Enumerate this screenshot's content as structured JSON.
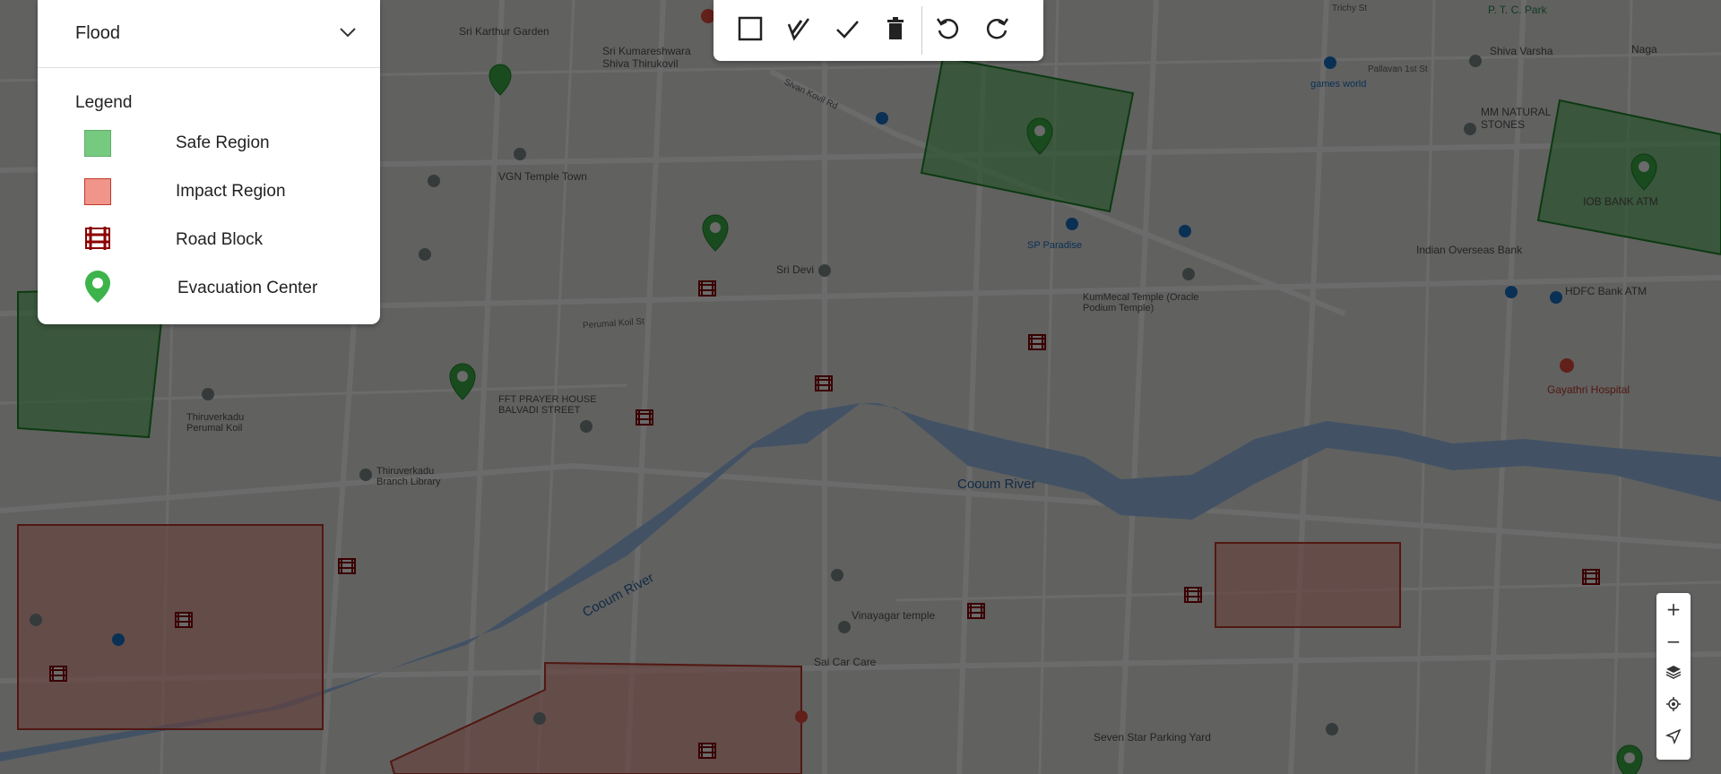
{
  "hazard_select": {
    "value": "Flood"
  },
  "legend": {
    "title": "Legend",
    "items": [
      {
        "label": "Safe Region",
        "color": "#3cb44b"
      },
      {
        "label": "Impact Region",
        "color": "#f1948a"
      },
      {
        "label": "Road Block",
        "icon": "road-block-icon"
      },
      {
        "label": "Evacuation Center",
        "icon": "evacuation-pin-icon"
      }
    ]
  },
  "toolbar": {
    "buttons": [
      {
        "icon": "rectangle-icon"
      },
      {
        "icon": "polyline-edit-icon"
      },
      {
        "icon": "check-icon"
      },
      {
        "icon": "trash-icon"
      },
      {
        "icon": "undo-icon"
      },
      {
        "icon": "redo-icon"
      }
    ]
  },
  "zoom_controls": {
    "zoom_in": "+",
    "zoom_out": "−"
  },
  "map": {
    "labels": [
      {
        "text": "Sri Karthur Garden",
        "kind": "poi"
      },
      {
        "text": "Sri Kumareshwara Shiva Thirukovil",
        "kind": "default"
      },
      {
        "text": "Sivan Kovil Rd",
        "kind": "street"
      },
      {
        "text": "VGN Temple Town",
        "kind": "default"
      },
      {
        "text": "Sri Devi",
        "kind": "default"
      },
      {
        "text": "Perumal Koil St",
        "kind": "street"
      },
      {
        "text": "SP Paradise",
        "kind": "poi"
      },
      {
        "text": "KumMecal Temple (Oracle Podium Temple)",
        "kind": "default"
      },
      {
        "text": "Indian Overseas Bank",
        "kind": "default"
      },
      {
        "text": "HDFC Bank ATM",
        "kind": "default"
      },
      {
        "text": "Gayathri Hospital",
        "kind": "hospital"
      },
      {
        "text": "Cooum River",
        "kind": "water"
      },
      {
        "text": "FFT PRAYER HOUSE BALVADI STREET",
        "kind": "default"
      },
      {
        "text": "Thiruverkadu Branch Library",
        "kind": "default"
      },
      {
        "text": "Thiruverkadu Perumal Koil",
        "kind": "default"
      },
      {
        "text": "Vinayagar temple",
        "kind": "default"
      },
      {
        "text": "Sai Car Care",
        "kind": "default"
      },
      {
        "text": "Seven Star Parking Yard",
        "kind": "default"
      },
      {
        "text": "games world",
        "kind": "poi"
      },
      {
        "text": "Shiva Varsha",
        "kind": "default"
      },
      {
        "text": "MM NATURAL STONES",
        "kind": "default"
      },
      {
        "text": "Pallavan 1st St",
        "kind": "street"
      },
      {
        "text": "Trichy St",
        "kind": "street"
      },
      {
        "text": "P. T. C. Park",
        "kind": "green"
      },
      {
        "text": "IOB BANK ATM",
        "kind": "default"
      },
      {
        "text": "Naga",
        "kind": "default"
      }
    ]
  }
}
